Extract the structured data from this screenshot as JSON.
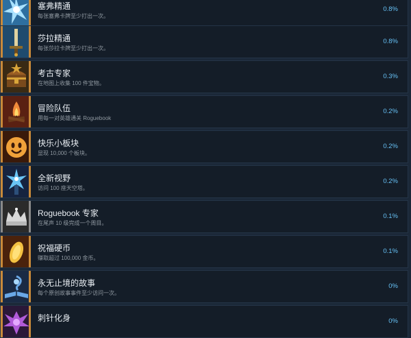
{
  "achievements": [
    {
      "title": "塞弗精通",
      "description": "每张塞弗卡牌至少打出一次。",
      "percent": "0.8%",
      "icon": "blue-star-burst-icon",
      "colors": [
        "#2e6fa0",
        "#a9e2ff",
        "#c98a3a"
      ]
    },
    {
      "title": "莎拉精通",
      "description": "每张莎拉卡牌至少打出一次。",
      "percent": "0.8%",
      "icon": "sword-icon",
      "colors": [
        "#1f4b6e",
        "#e0d2a0",
        "#c98a3a"
      ]
    },
    {
      "title": "考古专家",
      "description": "在地图上收集 100 件宝物。",
      "percent": "0.3%",
      "icon": "treasure-chest-icon",
      "colors": [
        "#3a2a14",
        "#d9a53a",
        "#c98a3a"
      ]
    },
    {
      "title": "冒险队伍",
      "description": "用每一对英雄通关 Roguebook",
      "percent": "0.2%",
      "icon": "campfire-icon",
      "colors": [
        "#5a2012",
        "#f08a3a",
        "#c98a3a"
      ]
    },
    {
      "title": "快乐小板块",
      "description": "显现 10,000 个板块。",
      "percent": "0.2%",
      "icon": "smiling-tile-icon",
      "colors": [
        "#3a1a0a",
        "#f0a23a",
        "#c98a3a"
      ]
    },
    {
      "title": "全新视野",
      "description": "访问 100 座天空塔。",
      "percent": "0.2%",
      "icon": "sky-tower-icon",
      "colors": [
        "#16233f",
        "#69c4f5",
        "#c98a3a"
      ]
    },
    {
      "title": "Roguebook 专家",
      "description": "在尾声 10 级完成一个周目。",
      "percent": "0.1%",
      "icon": "silver-crown-icon",
      "colors": [
        "#2b2b2b",
        "#d7d7d7",
        "#8a8a8a"
      ]
    },
    {
      "title": "祝福硬币",
      "description": "赚取超过 100,000 金币。",
      "percent": "0.1%",
      "icon": "gold-coin-icon",
      "colors": [
        "#4a220c",
        "#f4c141",
        "#c98a3a"
      ]
    },
    {
      "title": "永无止境的故事",
      "description": "每个原创故事事件至少访问一次。",
      "percent": "0%",
      "icon": "open-book-icon",
      "colors": [
        "#1a2a44",
        "#6aa8e6",
        "#c98a3a"
      ]
    },
    {
      "title": "刺针化身",
      "description": "",
      "percent": "0%",
      "icon": "spiky-creature-icon",
      "colors": [
        "#2a1838",
        "#b05ad8",
        "#c98a3a"
      ]
    }
  ]
}
